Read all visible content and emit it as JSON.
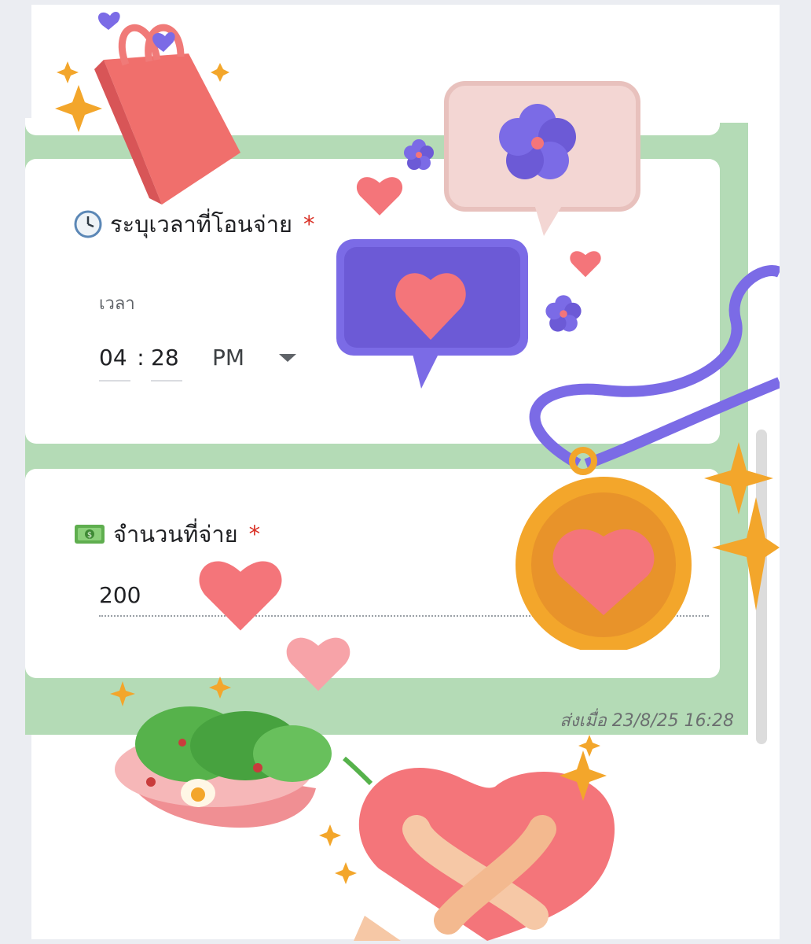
{
  "time_question": {
    "icon": "clock-icon",
    "title": "ระบุเวลาที่โอนจ่าย",
    "required_mark": "*",
    "sub_label": "เวลา",
    "hour": "04",
    "separator": ":",
    "minute": "28",
    "period": "PM"
  },
  "amount_question": {
    "icon": "money-icon",
    "title": "จำนวนที่จ่าย",
    "required_mark": "*",
    "value": "200"
  },
  "footer": {
    "timestamp": "ส่งเมื่อ 23/8/25 16:28"
  },
  "colors": {
    "form_green": "#b4dbb6",
    "required_red": "#d93025",
    "sticker_pink": "#f4757a",
    "sticker_purple": "#7b6be6",
    "sticker_gold": "#f3a62b"
  }
}
